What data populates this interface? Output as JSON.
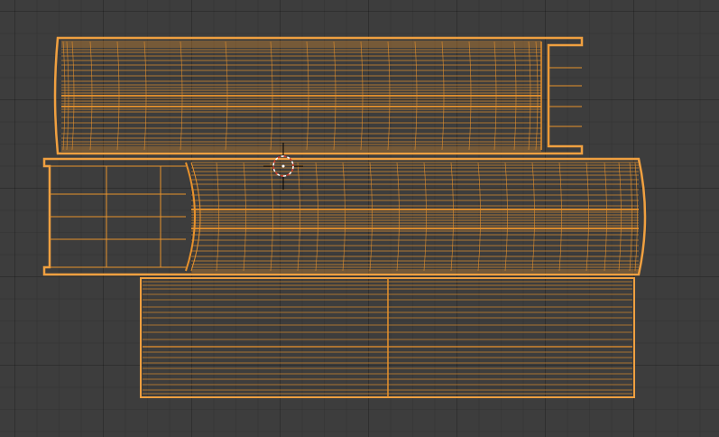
{
  "viewport": {
    "background_color": "#3d3d3d",
    "selection_color": "#e8922c",
    "selection_highlight": "#f5b041",
    "cursor_color": "#ffffff",
    "cursor_accent": "#d33a2a"
  },
  "objects": [
    {
      "name_icon": "mesh-wireframe-icon",
      "kind": "cylinder-lying"
    },
    {
      "name_icon": "mesh-wireframe-icon",
      "kind": "cylinder-lying"
    },
    {
      "name_icon": "mesh-wireframe-icon",
      "kind": "box"
    }
  ],
  "cursor_icon": "3d-cursor-icon"
}
